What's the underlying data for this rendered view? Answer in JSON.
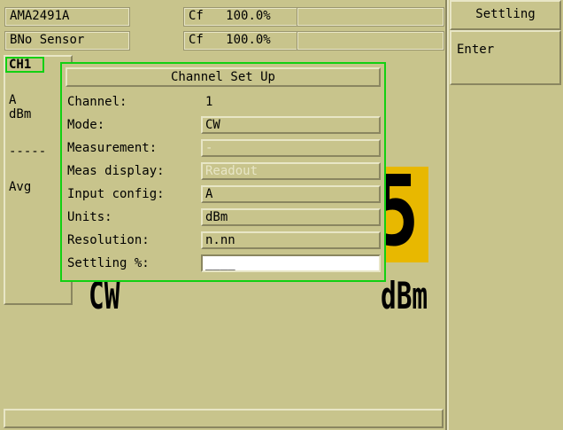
{
  "sensor_a": {
    "channel": "A",
    "name": "MA2491A",
    "cf_label": "Cf",
    "cf_value": "100.0%"
  },
  "sensor_b": {
    "channel": "B",
    "name": "No Sensor",
    "cf_label": "Cf",
    "cf_value": "100.0%"
  },
  "softkeys": {
    "title": "Settling",
    "enter": "Enter"
  },
  "left": {
    "channel_tag": "CH1",
    "input": "A",
    "units": "dBm",
    "dashes": "-----",
    "avg": "Avg"
  },
  "display": {
    "digit": "5",
    "unit": "dBm",
    "mode": "CW"
  },
  "dialog": {
    "title": "Channel Set Up",
    "rows": [
      {
        "label": "Channel:",
        "value": "1"
      },
      {
        "label": "Mode:",
        "value": "CW"
      },
      {
        "label": "Measurement:",
        "value": "-"
      },
      {
        "label": "Meas display:",
        "value": "Readout"
      },
      {
        "label": "Input config:",
        "value": "A"
      },
      {
        "label": "Units:",
        "value": "dBm"
      },
      {
        "label": "Resolution:",
        "value": "n.nn"
      },
      {
        "label": "Settling %:",
        "value": "____"
      }
    ]
  },
  "colors": {
    "background": "#c8c48c",
    "highlight": "#12d012",
    "readout": "#e8b800"
  }
}
